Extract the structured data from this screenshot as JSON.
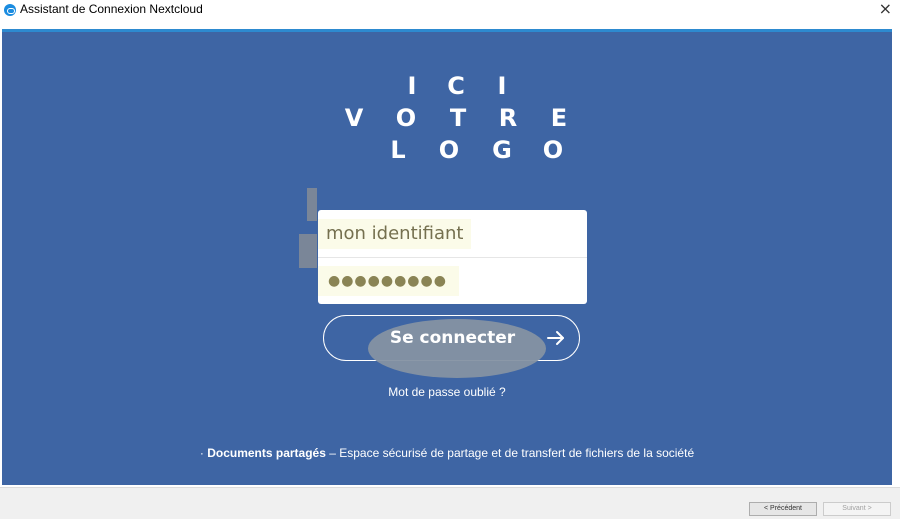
{
  "window": {
    "title": "Assistant de Connexion Nextcloud",
    "close_symbol": "×"
  },
  "logo": {
    "row1": [
      "I",
      "C",
      "I"
    ],
    "row2": [
      "V",
      "O",
      "T",
      "R",
      "E"
    ],
    "row3": [
      "L",
      "O",
      "G",
      "O"
    ]
  },
  "login": {
    "username_value": "mon identifiant",
    "password_value": "●●●●●●●●●",
    "connect_label": "Se connecter",
    "forgot_label": "Mot de passe oublié ?"
  },
  "footer": {
    "prefix": "· ",
    "bold": "Documents partagés",
    "rest": " – Espace sécurisé de partage et de transfert de fichiers de la société"
  },
  "wizard": {
    "previous_label": "< Précédent",
    "next_label": "Suivant >"
  },
  "colors": {
    "panel_background": "#3e65a4",
    "accent_top_border": "#2d8ad0",
    "autofill_background": "#fbfbe9"
  },
  "icons": {
    "app": "nextcloud-icon",
    "close": "close-icon",
    "submit": "arrow-right-icon"
  }
}
